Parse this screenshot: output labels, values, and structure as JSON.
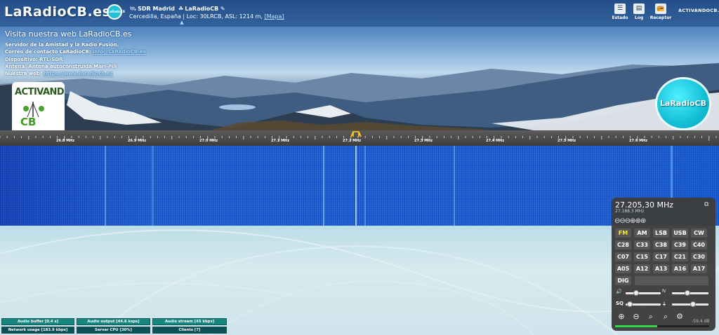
{
  "header": {
    "logo_text": "LaRadioCB.es",
    "badge_text": "LaRadioCB",
    "receiver_name": "SDR Madrid",
    "receiver_owner": "LaRadioCB",
    "location": "Cercedilla, España | Loc: 30LRCB, ASL: 1214 m,",
    "map_link": "[Mapa]",
    "collapse_icon": "chevron-up-icon",
    "buttons": [
      {
        "label": "Estado",
        "icon": "status-icon"
      },
      {
        "label": "Log",
        "icon": "log-icon"
      },
      {
        "label": "Receptor",
        "icon": "receiver-icon"
      }
    ],
    "partner_logo": "ACTIVANDOCB.COM"
  },
  "welcome": {
    "title": "Visita nuestra web LaRadioCB.es",
    "line1": "Servidor de la Amistad y la Radio Fusión.",
    "email_label": "Correo de contacto LaRadioCB:",
    "email": "info@LaRadioCB.es",
    "device": "Dispositivo: RTL-SDR",
    "antenna": "Antena: Antena autoconstruida Mari-Pili",
    "web_label": "Nuestra web:",
    "web_url": "https://www.laradiocb.es"
  },
  "logos": {
    "left_top": "ACTIVANDO",
    "left_bottom": "CB",
    "right": "LaRadioCB"
  },
  "scale": {
    "labels": [
      "26.8 MHz",
      "26.9 MHz",
      "27.0 MHz",
      "27.1 MHz",
      "27.2 MHz",
      "27.3 MHz",
      "27.4 MHz",
      "27.5 MHz",
      "27.6 MHz"
    ]
  },
  "status": {
    "audio_buffer": "Audio buffer [0.4 s]",
    "audio_output": "Audio output [44.6 ksps]",
    "audio_stream": "Audio stream [45 kbps]",
    "network_usage": "Network usage [183.9 kbps]",
    "server_cpu": "Server CPU [30%]",
    "clients": "Clients [7]"
  },
  "panel": {
    "frequency": "27.205,30 MHz",
    "sub_frequency": "27.188.3 MHz",
    "modes": [
      "FM",
      "AM",
      "LSB",
      "USB",
      "CW"
    ],
    "active_mode": "FM",
    "channels_row1": [
      "C28",
      "C33",
      "C38",
      "C39",
      "C40"
    ],
    "channels_row2": [
      "C07",
      "C15",
      "C17",
      "C21",
      "C30"
    ],
    "channels_row3": [
      "A05",
      "A12",
      "A13",
      "A16",
      "A17"
    ],
    "dig_label": "DIG",
    "volume_icon": "speaker-icon",
    "squelch_label": "SQ",
    "signal_level": "-59.4 dB",
    "smeter_level_percent": 45,
    "volume_level_percent": 25,
    "squelch_level_percent": 5
  },
  "colors": {
    "waterfall": "#1f5fd3",
    "status_bar": "#16867f",
    "panel_bg": "#3c3c3c",
    "active_mode": "#ffea2a",
    "smeter": "#31d64a"
  }
}
